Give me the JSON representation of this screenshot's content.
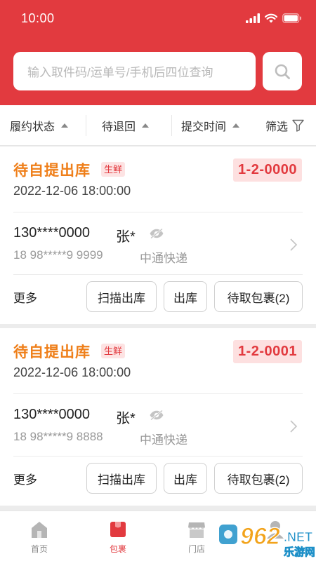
{
  "status_bar": {
    "time": "10:00"
  },
  "search": {
    "placeholder": "输入取件码/运单号/手机后四位查询",
    "search_icon": "search-icon"
  },
  "filters": [
    {
      "label": "履约状态"
    },
    {
      "label": "待退回"
    },
    {
      "label": "提交时间"
    },
    {
      "label": "筛选"
    }
  ],
  "cards": [
    {
      "status": "待自提出库",
      "tag": "生鲜",
      "pickup_code": "1-2-0000",
      "time": "2022-12-06 18:00:00",
      "phone": "130****0000",
      "name": "张*",
      "tracking": "18 98*****9 9999",
      "courier": "中通快递",
      "more": "更多",
      "actions": [
        "扫描出库",
        "出库",
        "待取包裹(2)"
      ]
    },
    {
      "status": "待自提出库",
      "tag": "生鲜",
      "pickup_code": "1-2-0001",
      "time": "2022-12-06 18:00:00",
      "phone": "130****0000",
      "name": "张*",
      "tracking": "18 98*****9 8888",
      "courier": "中通快递",
      "more": "更多",
      "actions": [
        "扫描出库",
        "出库",
        "待取包裹(2)"
      ]
    }
  ],
  "tab_bar": {
    "active_index": 1,
    "tabs": [
      {
        "label": "首页",
        "icon": "home-icon"
      },
      {
        "label": "包裹",
        "icon": "package-icon"
      },
      {
        "label": "门店",
        "icon": "store-icon"
      },
      {
        "label": "",
        "icon": "profile-icon"
      }
    ]
  },
  "watermark": {
    "text_main": "962",
    "text_suffix": ".NET",
    "text_sub": "乐游网"
  },
  "colors": {
    "brand_red": "#e23a3f",
    "status_orange": "#ef7f1a",
    "code_bg": "#fde0e0"
  }
}
